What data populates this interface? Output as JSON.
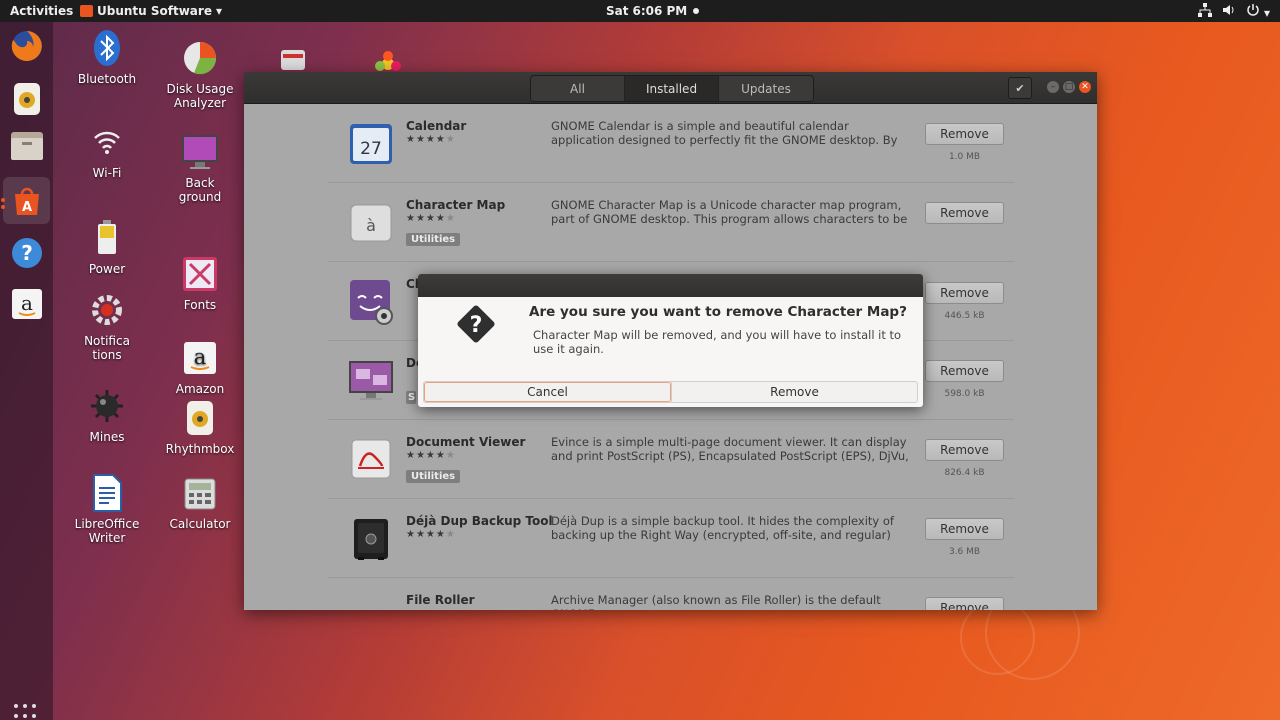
{
  "topbar": {
    "activities": "Activities",
    "app_menu": "Ubuntu Software",
    "day": "Sat",
    "time": "6:06 PM"
  },
  "dock": {
    "items": [
      "firefox-icon",
      "rhythmbox-icon",
      "files-icon",
      "ubuntu-software-icon",
      "help-icon",
      "amazon-icon"
    ]
  },
  "desktop": {
    "icons": [
      {
        "label": "Bluetooth"
      },
      {
        "label": "Disk Usage\nAnalyzer"
      },
      {
        "label": "Wi-Fi"
      },
      {
        "label": "Back\nground"
      },
      {
        "label": "Power"
      },
      {
        "label": "Fonts"
      },
      {
        "label": "Notifica\ntions"
      },
      {
        "label": "Amazon"
      },
      {
        "label": "Mines"
      },
      {
        "label": "Rhythmbox"
      },
      {
        "label": "LibreOffice\nWriter"
      },
      {
        "label": "Calculator"
      }
    ]
  },
  "window": {
    "tabs": [
      "All",
      "Installed",
      "Updates"
    ],
    "active_tab": "Installed",
    "rows": [
      {
        "name": "Calendar",
        "rating": 4,
        "category": "",
        "description": "GNOME Calendar is a simple and beautiful calendar application designed to perfectly fit the GNOME desktop. By reusing the co…",
        "button": "Remove",
        "size": "1.0 MB"
      },
      {
        "name": "Character Map",
        "rating": 4,
        "category": "Utilities",
        "description": "GNOME Character Map is a Unicode character map program, part of GNOME desktop. This program allows characters to be displa…",
        "button": "Remove",
        "size": ""
      },
      {
        "name": "Ch",
        "rating": 4,
        "category": "",
        "description": "",
        "button": "Remove",
        "size": "446.5 kB"
      },
      {
        "name": "De",
        "rating": 4,
        "category": "",
        "description": "",
        "button": "Remove",
        "size": "598.0 kB"
      },
      {
        "name": "Document Viewer",
        "rating": 4,
        "category": "Utilities",
        "description": "Evince is a simple multi-page document viewer.  It can display and print PostScript (PS), Encapsulated PostScript (EPS), DjVu, DVI, …",
        "button": "Remove",
        "size": "826.4 kB"
      },
      {
        "name": "Déjà Dup Backup Tool",
        "rating": 4,
        "category": "",
        "description": "Déjà Dup is a simple backup tool. It hides the complexity of backing up the Right Way (encrypted, off-site, and regular) and u…",
        "button": "Remove",
        "size": "3.6 MB"
      },
      {
        "name": "File Roller",
        "rating": 4,
        "category": "",
        "description": "Archive Manager (also known as File Roller) is the default GNOME",
        "button": "Remove",
        "size": ""
      }
    ]
  },
  "dialog": {
    "heading": "Are you sure you want to remove Character Map?",
    "body": "Character Map will be removed, and you will have to install it to use it again.",
    "cancel": "Cancel",
    "remove": "Remove"
  },
  "colors": {
    "accent": "#e95420",
    "topbar": "#1d1d1d",
    "headerbar": "#33322f"
  }
}
